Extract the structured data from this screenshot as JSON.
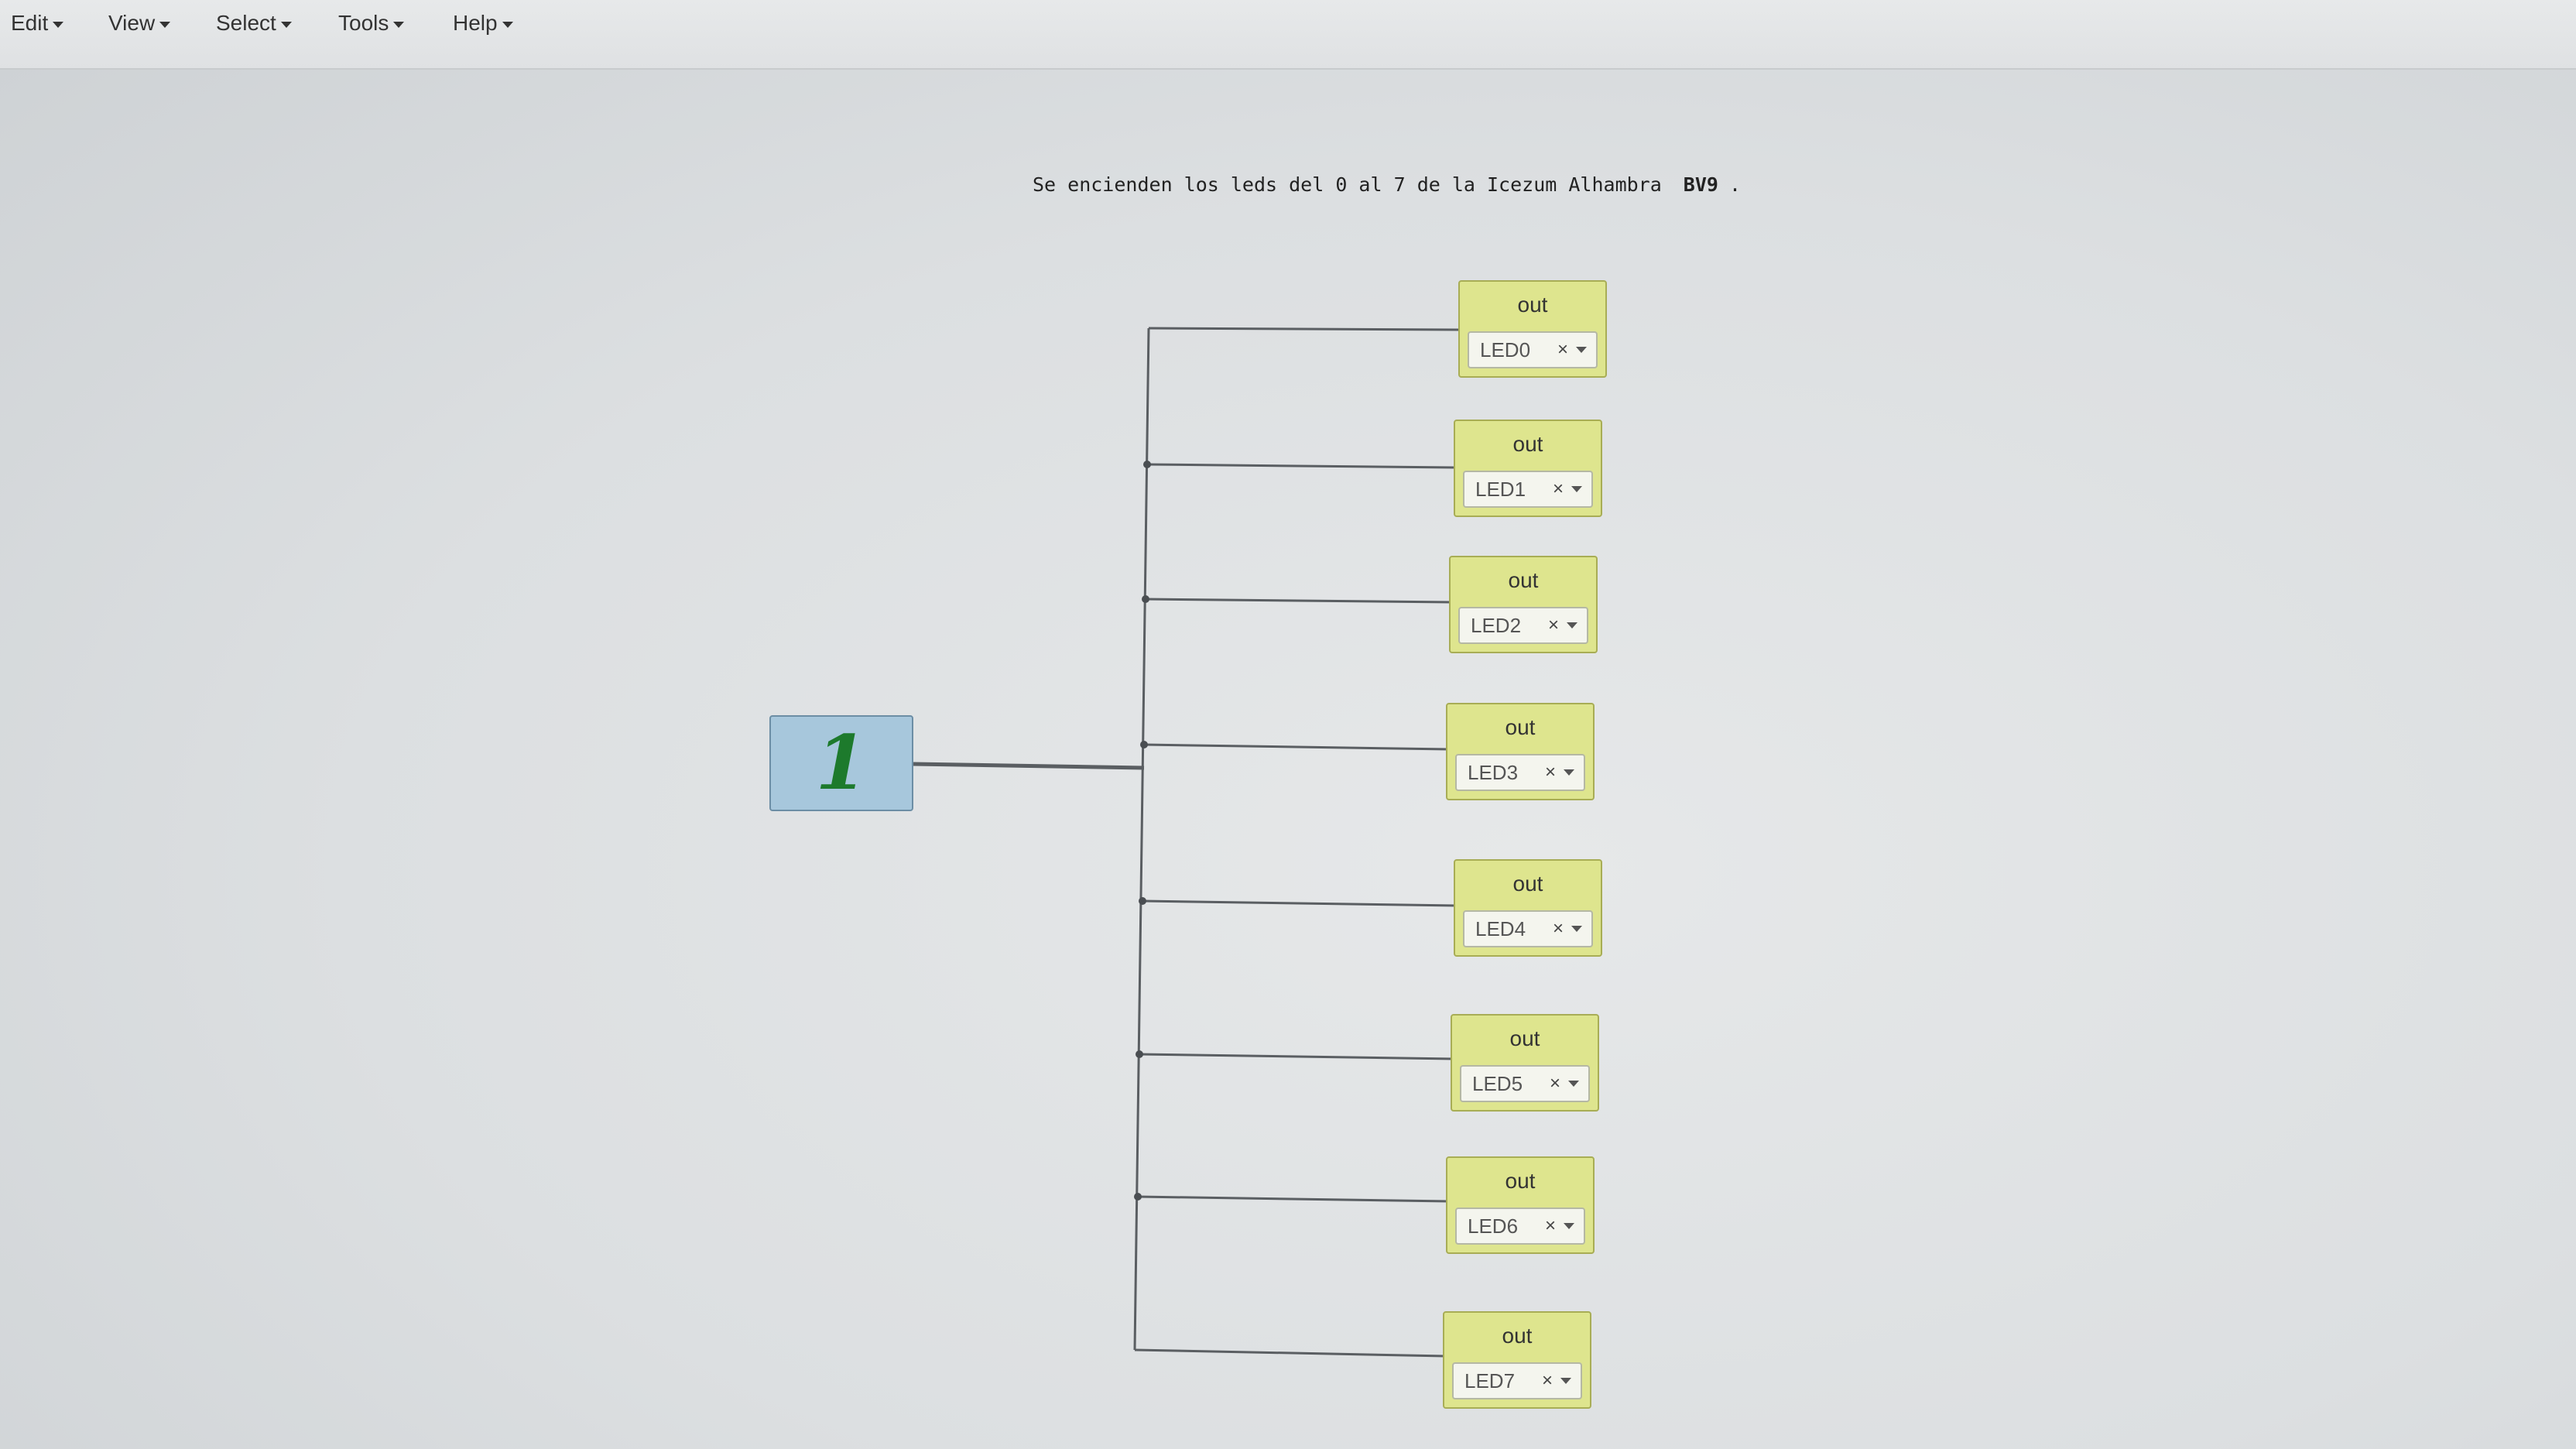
{
  "menu": [
    {
      "label": "Edit"
    },
    {
      "label": "View"
    },
    {
      "label": "Select"
    },
    {
      "label": "Tools"
    },
    {
      "label": "Help"
    }
  ],
  "description": {
    "text": "Se encienden los leds del 0 al 7 de la Icezum Alhambra",
    "bold": "BV9",
    "suffix": "."
  },
  "constant": {
    "value": "1"
  },
  "outputs": [
    {
      "label": "out",
      "pin": "LED0",
      "clear": "×"
    },
    {
      "label": "out",
      "pin": "LED1",
      "clear": "×"
    },
    {
      "label": "out",
      "pin": "LED2",
      "clear": "×"
    },
    {
      "label": "out",
      "pin": "LED3",
      "clear": "×"
    },
    {
      "label": "out",
      "pin": "LED4",
      "clear": "×"
    },
    {
      "label": "out",
      "pin": "LED5",
      "clear": "×"
    },
    {
      "label": "out",
      "pin": "LED6",
      "clear": "×"
    },
    {
      "label": "out",
      "pin": "LED7",
      "clear": "×"
    }
  ]
}
